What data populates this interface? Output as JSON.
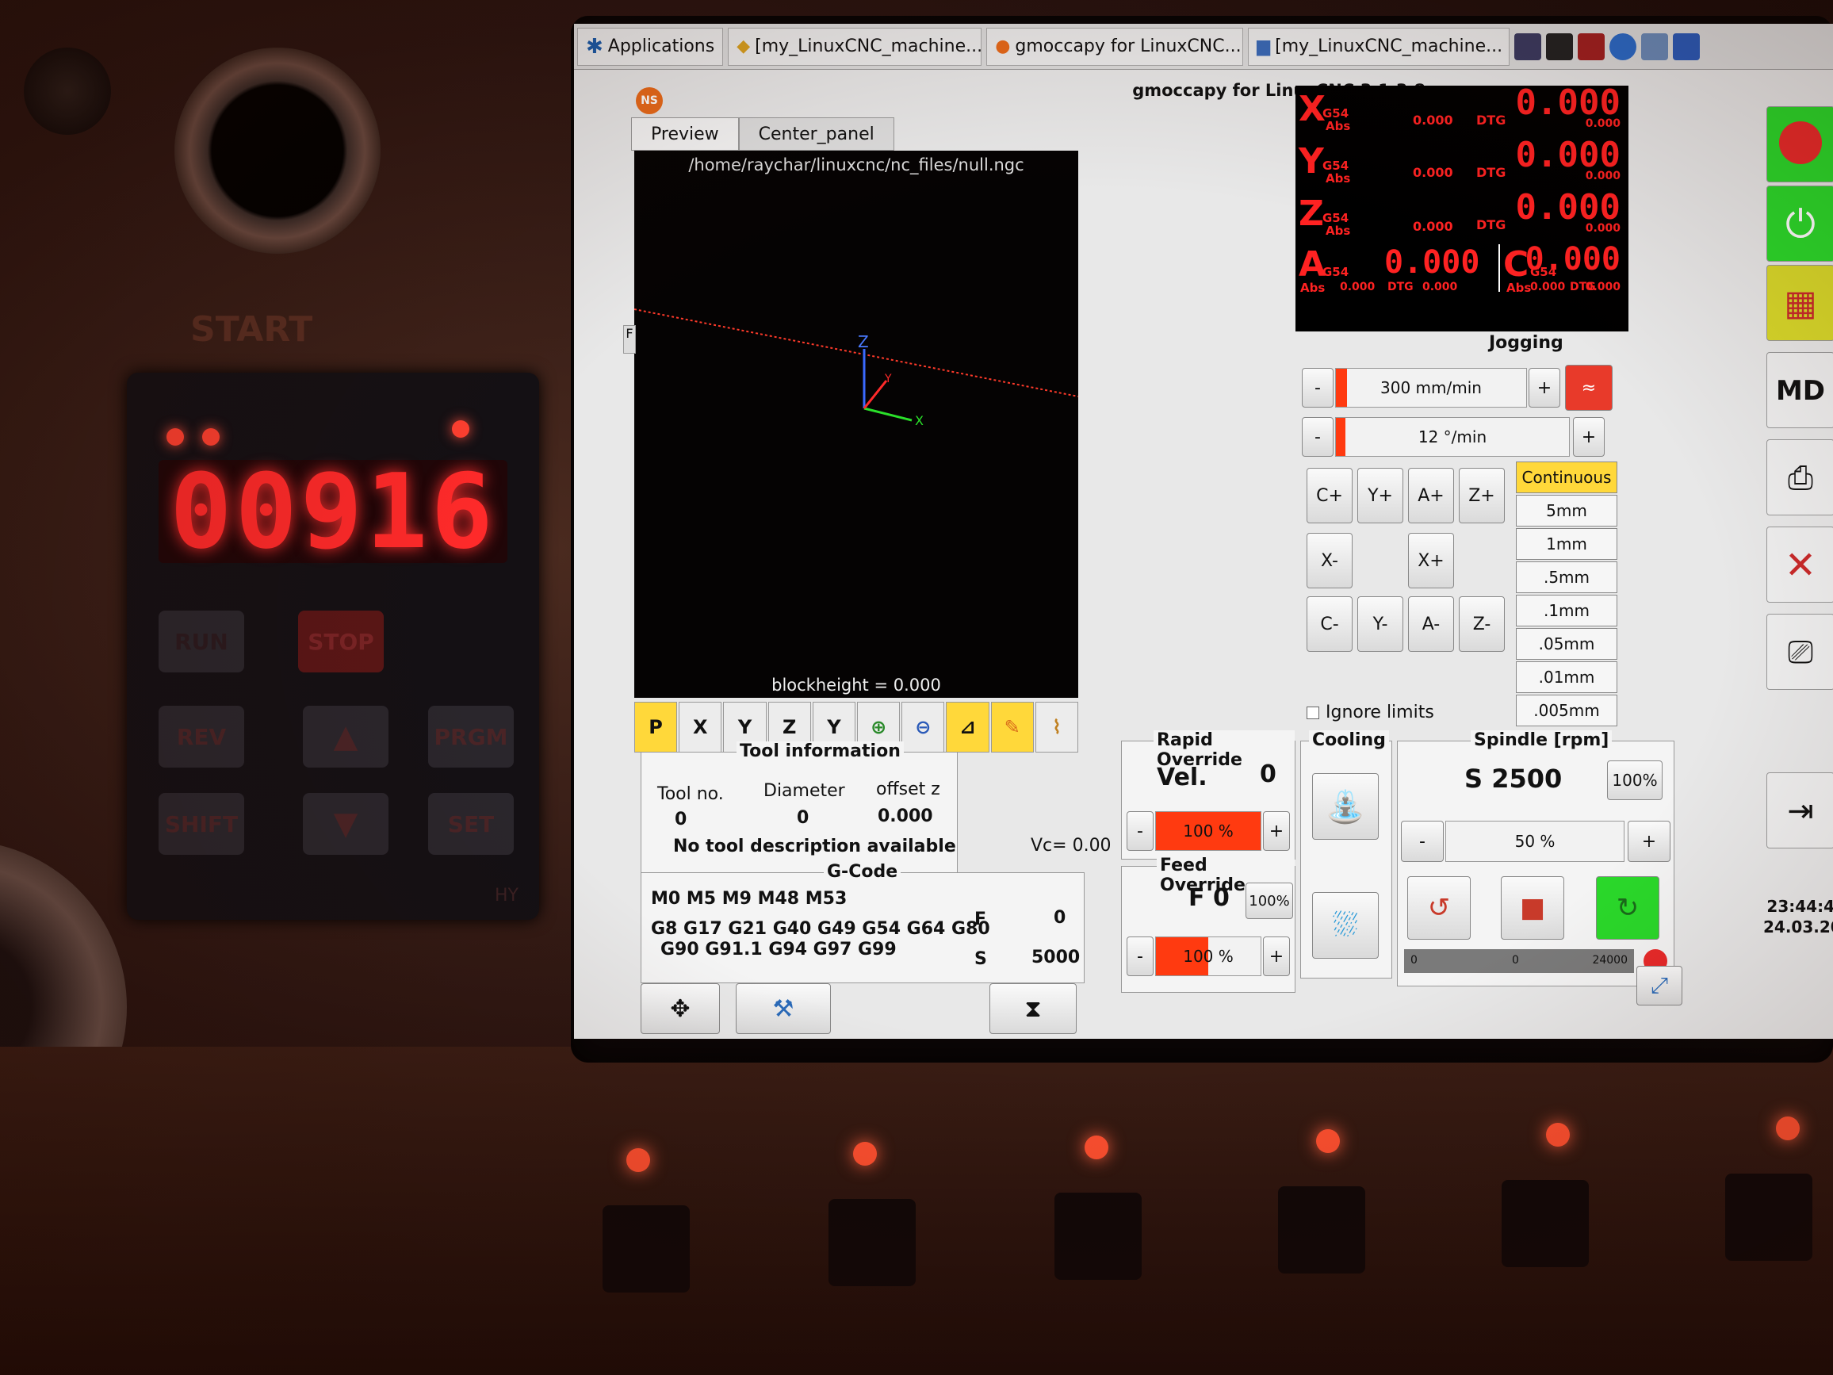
{
  "taskbar": {
    "apps_label": "Applications",
    "tasks": [
      "[my_LinuxCNC_machine...",
      "gmoccapy for LinuxCNC...",
      "[my_LinuxCNC_machine..."
    ]
  },
  "window": {
    "title": "gmoccapy for LinuxCNC  3.1.3.8",
    "logo": "NS"
  },
  "tabs": [
    {
      "label": "Preview",
      "active": true
    },
    {
      "label": "Center_panel",
      "active": false
    }
  ],
  "preview": {
    "file_path": "/home/raychar/linuxcnc/nc_files/null.ngc",
    "axis_labels": {
      "z": "Z",
      "x": "X",
      "y": "Y"
    },
    "blockheight": "blockheight = 0.000",
    "side_tab": "F"
  },
  "dro": {
    "axes": [
      {
        "axis": "X",
        "wcs": "G54",
        "mode": "Abs",
        "value": "0.000",
        "sub": "0.000",
        "dtg_label": "DTG",
        "dtg": "0.000"
      },
      {
        "axis": "Y",
        "wcs": "G54",
        "mode": "Abs",
        "value": "0.000",
        "sub": "0.000",
        "dtg_label": "DTG",
        "dtg": "0.000"
      },
      {
        "axis": "Z",
        "wcs": "G54",
        "mode": "Abs",
        "value": "0.000",
        "sub": "0.000",
        "dtg_label": "DTG",
        "dtg": "0.000"
      }
    ],
    "a_axis": {
      "axis": "A",
      "wcs": "G54",
      "mode": "Abs",
      "value": "0.000",
      "sub": "0.000",
      "dtg_label": "DTG",
      "dtg": "0.000"
    },
    "c_axis": {
      "axis": "C",
      "wcs": "G54",
      "mode": "Abs",
      "value": "0.000",
      "sub": "0.000",
      "dtg_label": "DTG",
      "dtg": "0.000"
    }
  },
  "jogging": {
    "title": "Jogging",
    "linear_speed": "300 mm/min",
    "linear_fraction": 0.06,
    "angular_speed": "12 °/min",
    "angular_fraction": 0.04,
    "minus": "-",
    "plus": "+",
    "buttons": {
      "c_plus": "C+",
      "y_plus": "Y+",
      "a_plus": "A+",
      "z_plus": "Z+",
      "x_minus": "X-",
      "x_plus": "X+",
      "c_minus": "C-",
      "y_minus": "Y-",
      "a_minus": "A-",
      "z_minus": "Z-"
    },
    "increments": [
      "Continuous",
      "5mm",
      "1mm",
      ".5mm",
      ".1mm",
      ".05mm",
      ".01mm",
      ".005mm"
    ],
    "selected_increment": "Continuous",
    "ignore_limits": "Ignore limits"
  },
  "tool_info": {
    "title": "Tool information",
    "col_tool": "Tool no.",
    "col_diameter": "Diameter",
    "col_offset": "offset z",
    "tool_no": "0",
    "diameter": "0",
    "offset_z": "0.000",
    "description": "No tool description available",
    "vc": "Vc= 0.00"
  },
  "gcode": {
    "title": "G-Code",
    "line1": "M0 M5 M9 M48 M53",
    "line2": "G8 G17 G21 G40 G49 G54 G64 G80",
    "line3": "G90 G91.1 G94 G97 G99",
    "f_label": "F",
    "f_value": "0",
    "s_label": "S",
    "s_value": "5000"
  },
  "rapid_override": {
    "title": "Rapid Override",
    "vel_label": "Vel.",
    "vel_value": "0",
    "percent": "100 %",
    "fraction": 1.0
  },
  "feed_override": {
    "title": "Feed Override",
    "f_display": "F  0",
    "reset": "100%",
    "percent": "100 %",
    "fraction": 0.5
  },
  "cooling": {
    "title": "Cooling"
  },
  "spindle": {
    "title": "Spindle [rpm]",
    "speed": "S 2500",
    "reset": "100%",
    "override": "50 %",
    "override_fraction": 0.5,
    "bar_min": "0",
    "bar_mid": "0",
    "bar_max": "24000"
  },
  "clock": {
    "time": "23:44:4",
    "date": "24.03.202"
  },
  "hardware": {
    "vfd_display": "00916",
    "vfd_buttons": [
      "REV",
      "PRGM",
      "SHIFT",
      "SET",
      "RUN",
      "STOP"
    ],
    "vfd_brand": "HY",
    "start_label": "START"
  },
  "colors": {
    "dro_red": "#ff2222",
    "override_fill": "#ff3a10",
    "selected_yellow": "#ffd83a"
  }
}
